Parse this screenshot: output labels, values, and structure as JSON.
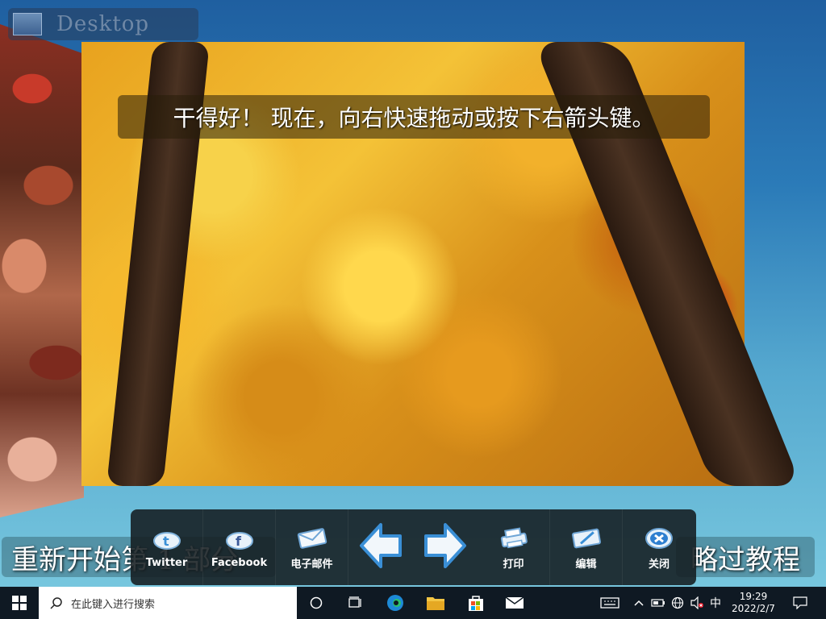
{
  "desktop": {
    "label": "Desktop"
  },
  "instruction": {
    "text": "干得好！ 现在，向右快速拖动或按下右箭头键。"
  },
  "bottom": {
    "restart_label": "重新开始第 1 部分",
    "skip_label": "略过教程"
  },
  "toolbar": {
    "twitter_label": "Twitter",
    "facebook_label": "Facebook",
    "email_label": "电子邮件",
    "print_label": "打印",
    "edit_label": "编辑",
    "close_label": "关闭"
  },
  "taskbar": {
    "search_placeholder": "在此键入进行搜索",
    "ime_label": "中",
    "time": "19:29",
    "date": "2022/2/7"
  },
  "colors": {
    "toolbar_bg": "#141c20",
    "arrow_blue": "#3a8fd6",
    "close_blue": "#2e7fd0"
  }
}
